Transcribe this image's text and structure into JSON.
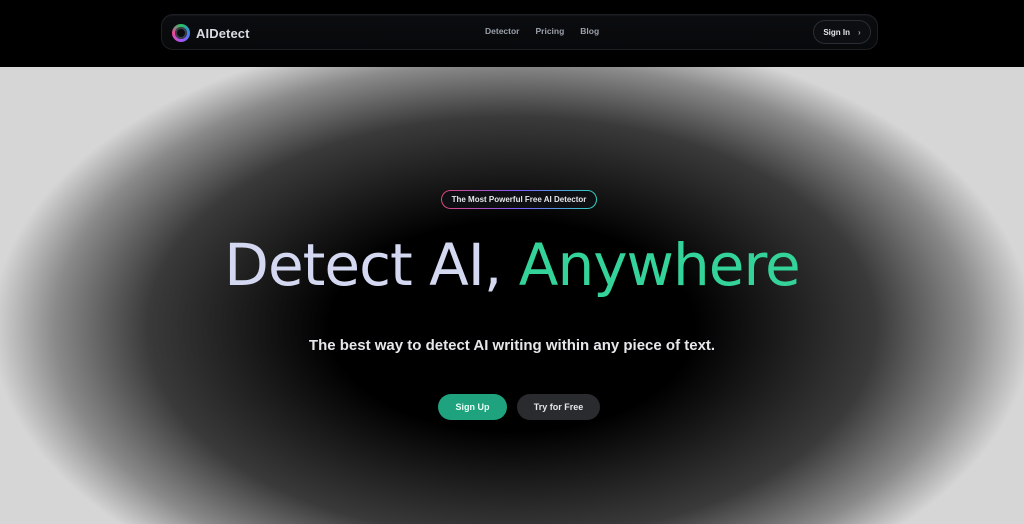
{
  "nav": {
    "brand": "AIDetect",
    "links": [
      "Detector",
      "Pricing",
      "Blog"
    ],
    "signin": "Sign In",
    "signin_chevron": "›"
  },
  "hero": {
    "badge": "The Most Powerful Free AI Detector",
    "headline_part1": "Detect AI,",
    "headline_part2": "Anywhere",
    "subtitle": "The best way to detect AI writing within any piece of text.",
    "signup": "Sign Up",
    "try_free": "Try for Free"
  },
  "colors": {
    "accent": "#34d399",
    "button_primary": "#1ea37e",
    "headline": "#d4d8f0"
  }
}
